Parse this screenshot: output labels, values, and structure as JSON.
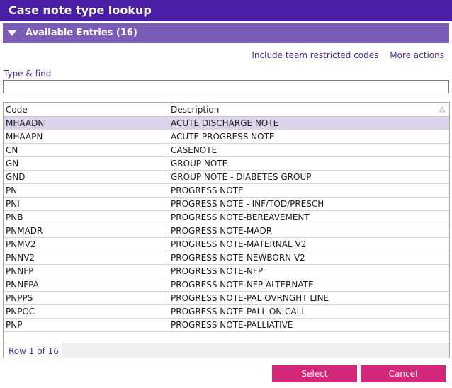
{
  "title": "Case note type lookup",
  "section": {
    "label": "Available Entries (16)"
  },
  "links": {
    "include_team": "Include team restricted codes",
    "more_actions": "More actions"
  },
  "find": {
    "label": "Type & find",
    "value": ""
  },
  "table": {
    "headers": {
      "code": "Code",
      "description": "Description"
    },
    "sort_indicator": "△",
    "rows": [
      {
        "code": "MHAADN",
        "description": "ACUTE DISCHARGE NOTE",
        "selected": true
      },
      {
        "code": "MHAAPN",
        "description": "ACUTE PROGRESS NOTE"
      },
      {
        "code": "CN",
        "description": "CASENOTE"
      },
      {
        "code": "GN",
        "description": "GROUP NOTE"
      },
      {
        "code": "GND",
        "description": "GROUP NOTE - DIABETES GROUP"
      },
      {
        "code": "PN",
        "description": "PROGRESS NOTE"
      },
      {
        "code": "PNI",
        "description": "PROGRESS NOTE - INF/TOD/PRESCH"
      },
      {
        "code": "PNB",
        "description": "PROGRESS NOTE-BEREAVEMENT"
      },
      {
        "code": "PNMADR",
        "description": "PROGRESS NOTE-MADR"
      },
      {
        "code": "PNMV2",
        "description": "PROGRESS NOTE-MATERNAL V2"
      },
      {
        "code": "PNNV2",
        "description": "PROGRESS NOTE-NEWBORN V2"
      },
      {
        "code": "PNNFP",
        "description": "PROGRESS NOTE-NFP"
      },
      {
        "code": "PNNFPA",
        "description": "PROGRESS NOTE-NFP ALTERNATE"
      },
      {
        "code": "PNPPS",
        "description": "PROGRESS NOTE-PAL OVRNGHT LINE"
      },
      {
        "code": "PNPOC",
        "description": "PROGRESS NOTE-PALL ON CALL"
      },
      {
        "code": "PNP",
        "description": "PROGRESS NOTE-PALLIATIVE"
      }
    ],
    "row_count": "Row 1 of 16"
  },
  "buttons": {
    "select": "Select",
    "cancel": "Cancel"
  },
  "colors": {
    "title_bar": "#4a1fa6",
    "section_bar": "#7b5db8",
    "link": "#4a2a9a",
    "button": "#d6267a",
    "selected_row": "#dcd4ec"
  }
}
